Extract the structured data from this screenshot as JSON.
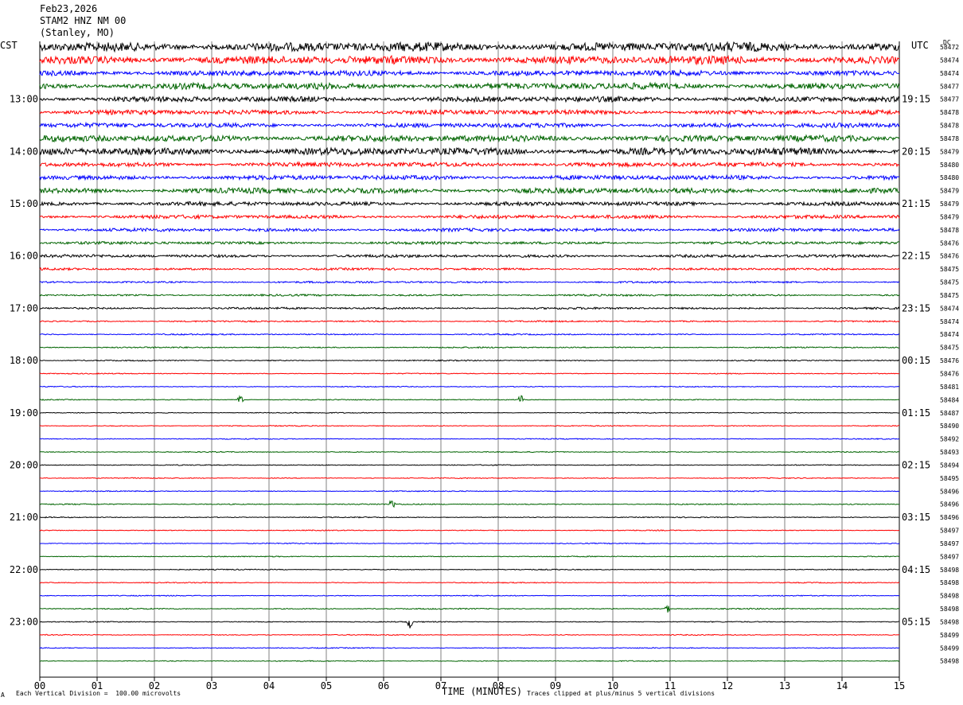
{
  "header": {
    "date": "Feb23,2026",
    "station": "STAM2 HNZ NM 00",
    "location": "(Stanley, MO)"
  },
  "left_tz": "CST",
  "right_tz": "UTC",
  "dc_header": "DC",
  "footer": {
    "scale_note": "Each Vertical Division =  100.00 microvolts",
    "xlabel": "TIME (MINUTES)",
    "clip_note": "Traces clipped at plus/minus 5 vertical divisions",
    "corner_mark": "A"
  },
  "colors": {
    "c0": "#000000",
    "c1": "#ff0000",
    "c2": "#0000ff",
    "c3": "#006400",
    "grid": "#808080"
  },
  "chart_data": {
    "type": "line",
    "xlabel": "TIME (MINUTES)",
    "xlim": [
      0,
      15
    ],
    "x_ticks": [
      "00",
      "01",
      "02",
      "03",
      "04",
      "05",
      "06",
      "07",
      "08",
      "09",
      "10",
      "11",
      "12",
      "13",
      "14",
      "15"
    ],
    "rows": 48,
    "left_hour_labels": [
      "13:00",
      "14:00",
      "15:00",
      "16:00",
      "17:00",
      "18:00",
      "19:00",
      "20:00",
      "21:00",
      "22:00",
      "23:00"
    ],
    "right_hour_labels": [
      "19:15",
      "20:15",
      "21:15",
      "22:15",
      "23:15",
      "00:15",
      "01:15",
      "02:15",
      "03:15",
      "04:15",
      "05:15"
    ],
    "dc_values": [
      "58472",
      "58474",
      "58474",
      "58477",
      "58477",
      "58478",
      "58478",
      "58478",
      "58479",
      "58480",
      "58480",
      "58479",
      "58479",
      "58479",
      "58478",
      "58476",
      "58476",
      "58475",
      "58475",
      "58475",
      "58474",
      "58474",
      "58474",
      "58475",
      "58476",
      "58476",
      "58481",
      "58484",
      "58487",
      "58490",
      "58492",
      "58493",
      "58494",
      "58495",
      "58496",
      "58496",
      "58496",
      "58497",
      "58497",
      "58497",
      "58498",
      "58498",
      "58498",
      "58498",
      "58498",
      "58499",
      "58499",
      "58498"
    ],
    "amplitudes": [
      5,
      4.5,
      3,
      3.5,
      3,
      2.5,
      2.5,
      3.5,
      4,
      2.5,
      2.5,
      3,
      2.2,
      2,
      1.8,
      1.5,
      1.6,
      1.2,
      1,
      1,
      1.1,
      0.8,
      0.7,
      0.7,
      0.6,
      0.5,
      0.5,
      0.5,
      0.5,
      0.5,
      0.5,
      0.5,
      0.5,
      0.5,
      0.5,
      0.6,
      0.5,
      0.5,
      0.5,
      0.5,
      0.5,
      0.5,
      0.5,
      0.6,
      0.5,
      0.5,
      0.5,
      0.5
    ],
    "spikes": [
      {
        "row": 27,
        "minute": 3.5,
        "amp": 3
      },
      {
        "row": 27,
        "minute": 8.4,
        "amp": 4
      },
      {
        "row": 35,
        "minute": 6.15,
        "amp": 4
      },
      {
        "row": 44,
        "minute": 6.45,
        "amp": 6
      },
      {
        "row": 43,
        "minute": 10.95,
        "amp": 3
      }
    ]
  }
}
